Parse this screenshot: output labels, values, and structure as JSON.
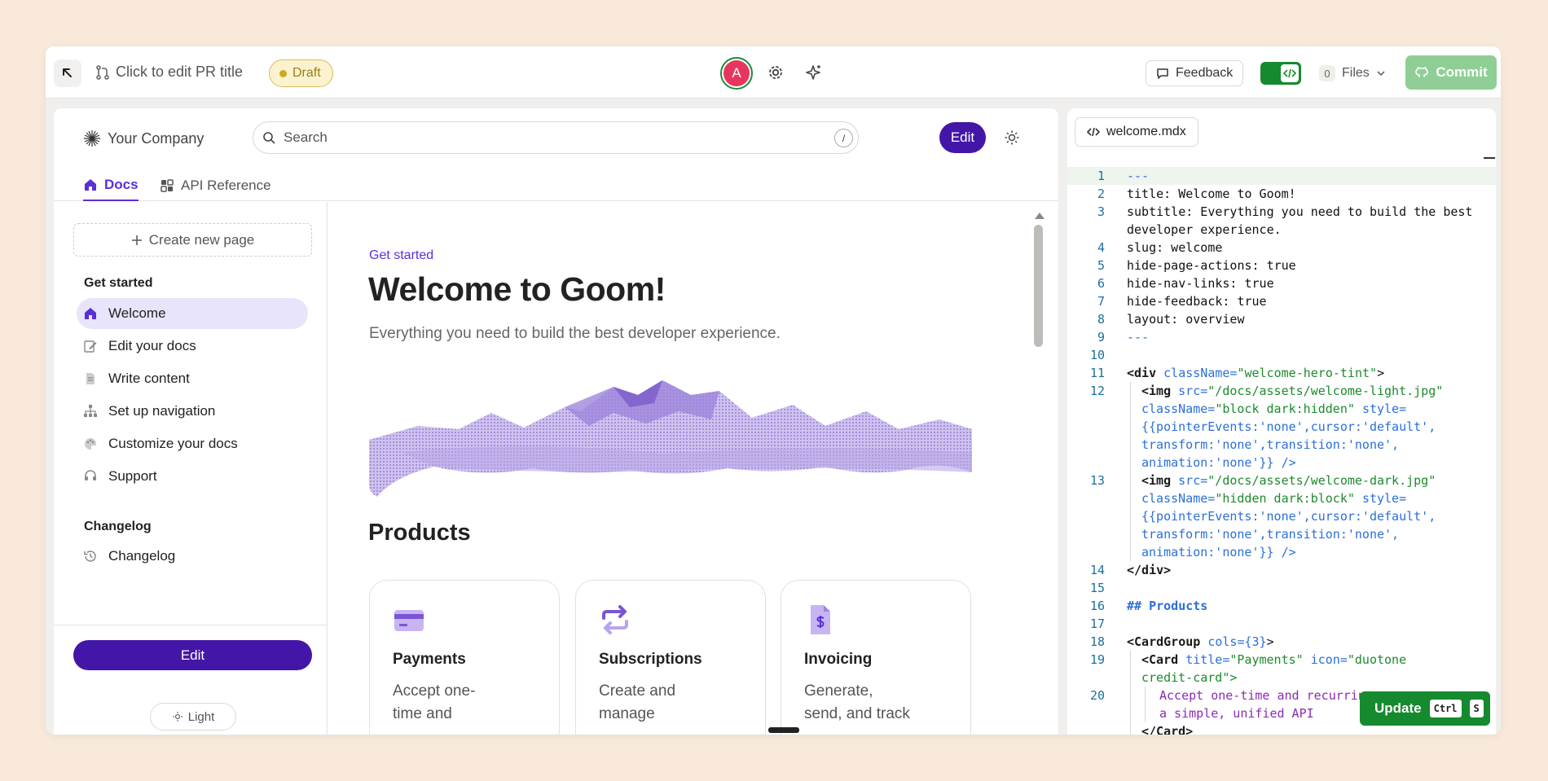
{
  "topbar": {
    "pr_title": "Click to edit PR title",
    "draft_label": "Draft",
    "avatar_initial": "A",
    "feedback_label": "Feedback",
    "files_count": "0",
    "files_label": "Files",
    "commit_label": "Commit"
  },
  "preview": {
    "company_name": "Your Company",
    "search_placeholder": "Search",
    "search_shortcut": "/",
    "edit_label": "Edit",
    "tabs": [
      {
        "label": "Docs",
        "active": true
      },
      {
        "label": "API Reference",
        "active": false
      }
    ],
    "sidebar": {
      "create_page_label": "Create new page",
      "group1_title": "Get started",
      "items": [
        {
          "label": "Welcome",
          "icon": "home-icon",
          "active": true
        },
        {
          "label": "Edit your docs",
          "icon": "pencil-icon"
        },
        {
          "label": "Write content",
          "icon": "document-icon"
        },
        {
          "label": "Set up navigation",
          "icon": "sitemap-icon"
        },
        {
          "label": "Customize your docs",
          "icon": "palette-icon"
        },
        {
          "label": "Support",
          "icon": "headset-icon"
        }
      ],
      "group2_title": "Changelog",
      "changelog_item": "Changelog",
      "edit_button": "Edit",
      "theme_label": "Light"
    },
    "page": {
      "eyebrow": "Get started",
      "title": "Welcome to Goom!",
      "subtitle": "Everything you need to build the best developer experience.",
      "products_heading": "Products",
      "cards": [
        {
          "title": "Payments",
          "desc": "Accept one-time and",
          "icon": "credit-card-icon"
        },
        {
          "title": "Subscriptions",
          "desc": "Create and manage",
          "icon": "repeat-icon"
        },
        {
          "title": "Invoicing",
          "desc": "Generate, send, and track",
          "icon": "invoice-icon"
        }
      ]
    }
  },
  "code": {
    "file_name": "welcome.mdx",
    "line_numbers": [
      "1",
      "2",
      "3",
      "4",
      "5",
      "6",
      "7",
      "8",
      "9",
      "10",
      "11",
      "12",
      "13",
      "14",
      "15",
      "16",
      "17",
      "18",
      "19",
      "20"
    ],
    "lines": {
      "l1": "---",
      "l2": "title: Welcome to Goom!",
      "l3": "subtitle: Everything you need to build the best developer experience.",
      "l4": "slug: welcome",
      "l5": "hide-page-actions: true",
      "l6": "hide-nav-links: true",
      "l7": "hide-feedback: true",
      "l8": "layout: overview",
      "l9": "---",
      "l11_tag": "<div",
      "l11_attr": "className=",
      "l11_str": "\"welcome-hero-tint\"",
      "l11_end": ">",
      "l12_tag": "<img",
      "l12_attr": "src=",
      "l12_str": "\"/docs/assets/welcome-light.jpg\"",
      "l12_b_attr": "className=",
      "l12_b_str": "\"block dark:hidden\"",
      "l12_b_attr2": "style=",
      "l12_c": "{{pointerEvents:'none',cursor:'default',",
      "l12_d": "transform:'none',transition:'none',",
      "l12_e": "animation:'none'}} />",
      "l13_tag": "<img",
      "l13_attr": "src=",
      "l13_str": "\"/docs/assets/welcome-dark.jpg\"",
      "l13_b_attr": "className=",
      "l13_b_str": "\"hidden dark:block\"",
      "l13_b_attr2": "style=",
      "l13_c": "{{pointerEvents:'none',cursor:'default',",
      "l13_d": "transform:'none',transition:'none',",
      "l13_e": "animation:'none'}} />",
      "l14": "</div>",
      "l16": "## Products",
      "l18_tag": "<CardGroup",
      "l18_attr": "cols=",
      "l18_val": "{3}",
      "l18_end": ">",
      "l19_tag": "<Card",
      "l19_attr": "title=",
      "l19_str": "\"Payments\"",
      "l19_attr2": "icon=",
      "l19_str2": "\"duotone",
      "l19_b": "credit-card\">",
      "l20_a": "Accept one-time and recurring",
      "l20_b": "a simple, unified API",
      "l21": "</Card>"
    },
    "update_label": "Update",
    "update_kbd1": "Ctrl",
    "update_kbd2": "S"
  },
  "colors": {
    "accent": "#4316a8",
    "brand_purple": "#5b2fd8",
    "commit_green": "#8fcf95",
    "toggle_green": "#158a2e",
    "background": "#f8e9db"
  }
}
